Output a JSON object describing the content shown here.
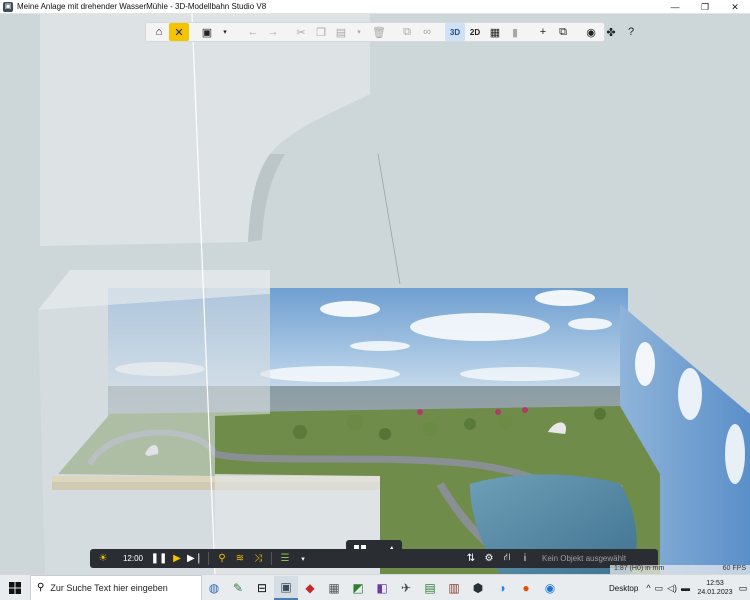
{
  "window": {
    "title": "Meine Anlage mit drehender WasserMühle - 3D-Modellbahn Studio V8",
    "controls": [
      "—",
      "❐",
      "✕"
    ]
  },
  "toolbar": {
    "buttons": [
      {
        "name": "home-icon",
        "glyph": "⌂"
      },
      {
        "name": "tools-icon",
        "glyph": "✕"
      },
      {
        "name": "save-icon",
        "glyph": "▣"
      },
      {
        "name": "undo-icon",
        "glyph": "←"
      },
      {
        "name": "redo-icon",
        "glyph": "→"
      },
      {
        "name": "cut-icon",
        "glyph": "✂"
      },
      {
        "name": "copy-icon",
        "glyph": "❐"
      },
      {
        "name": "paste-icon",
        "glyph": "▤"
      },
      {
        "name": "delete-icon",
        "glyph": "🗑"
      },
      {
        "name": "duplicate-icon",
        "glyph": "⧉"
      },
      {
        "name": "link-icon",
        "glyph": "∞"
      }
    ],
    "mode_3d": "3D",
    "mode_2d": "2D",
    "grid_icon": "▦",
    "lock_icon": "▮",
    "add_icon": "+",
    "layers_icon": "⧉",
    "camera_icon": "◉",
    "plugin_icon": "✤",
    "help_icon": "?"
  },
  "bottombar": {
    "time": "12:00",
    "status": "Kein Objekt ausgewählt"
  },
  "scale": {
    "label": "1:87 (H0) in mm",
    "fps": "60 FPS"
  },
  "taskbar": {
    "search_placeholder": "Zur Suche Text hier eingeben",
    "desktop_label": "Desktop",
    "time": "12:53",
    "date": "24.01.2023"
  }
}
